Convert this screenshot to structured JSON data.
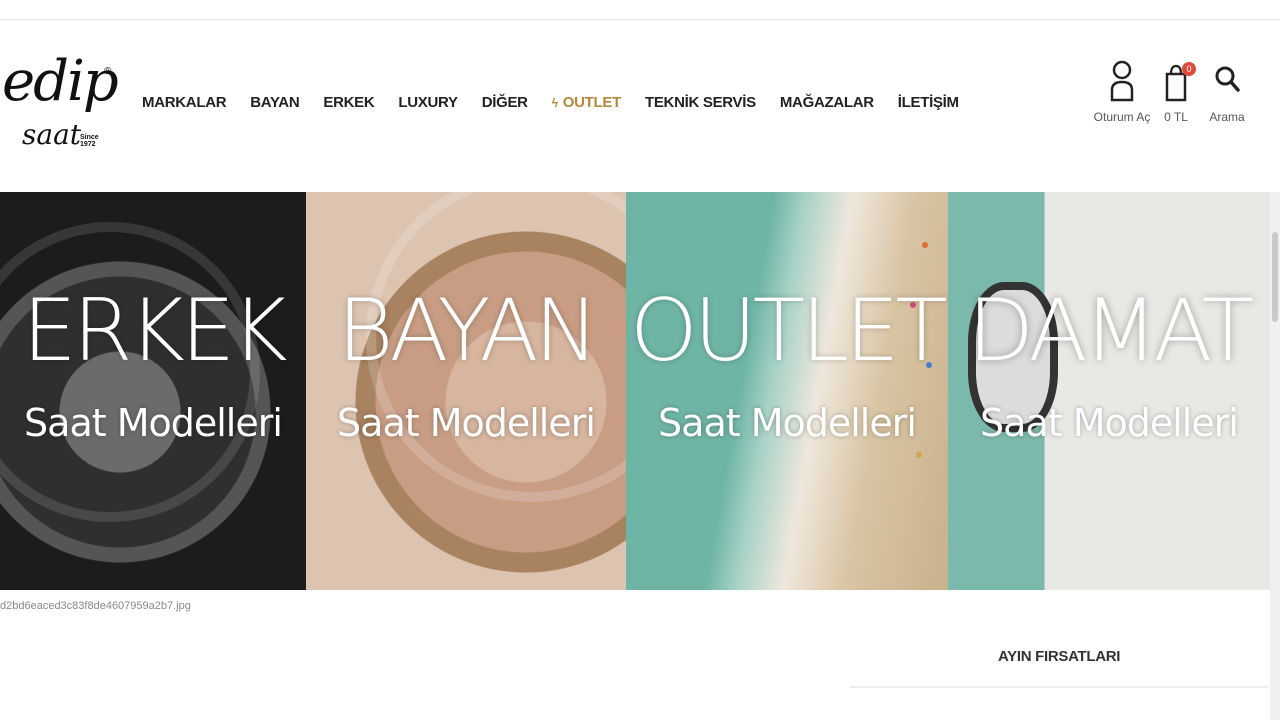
{
  "logo": {
    "main": "edip",
    "sub": "saat",
    "reg": "®",
    "since": "Since 1972"
  },
  "nav": {
    "items": [
      "MARKALAR",
      "BAYAN",
      "ERKEK",
      "LUXURY",
      "DİĞER",
      "OUTLET",
      "TEKNİK SERVİS",
      "MAĞAZALAR",
      "İLETİŞİM"
    ],
    "outlet_icon": "lightning-icon",
    "outlet_color": "#b6863c"
  },
  "actions": {
    "user_label": "Oturum Aç",
    "cart_label": "0 TL",
    "cart_count": "0",
    "search_label": "Arama"
  },
  "banners": [
    {
      "title": "ERKEK",
      "subtitle": "Saat Modelleri"
    },
    {
      "title": "BAYAN",
      "subtitle": "Saat Modelleri"
    },
    {
      "title": "OUTLET",
      "subtitle": "Saat Modelleri"
    },
    {
      "title": "DAMAT",
      "subtitle": "Saat Modelleri"
    }
  ],
  "filename": "d2bd6eaced3c83f8de4607959a2b7.jpg",
  "section": {
    "title": "AYIN FIRSATLARI"
  },
  "colors": {
    "badge": "#e0483a",
    "accent": "#b6863c"
  }
}
